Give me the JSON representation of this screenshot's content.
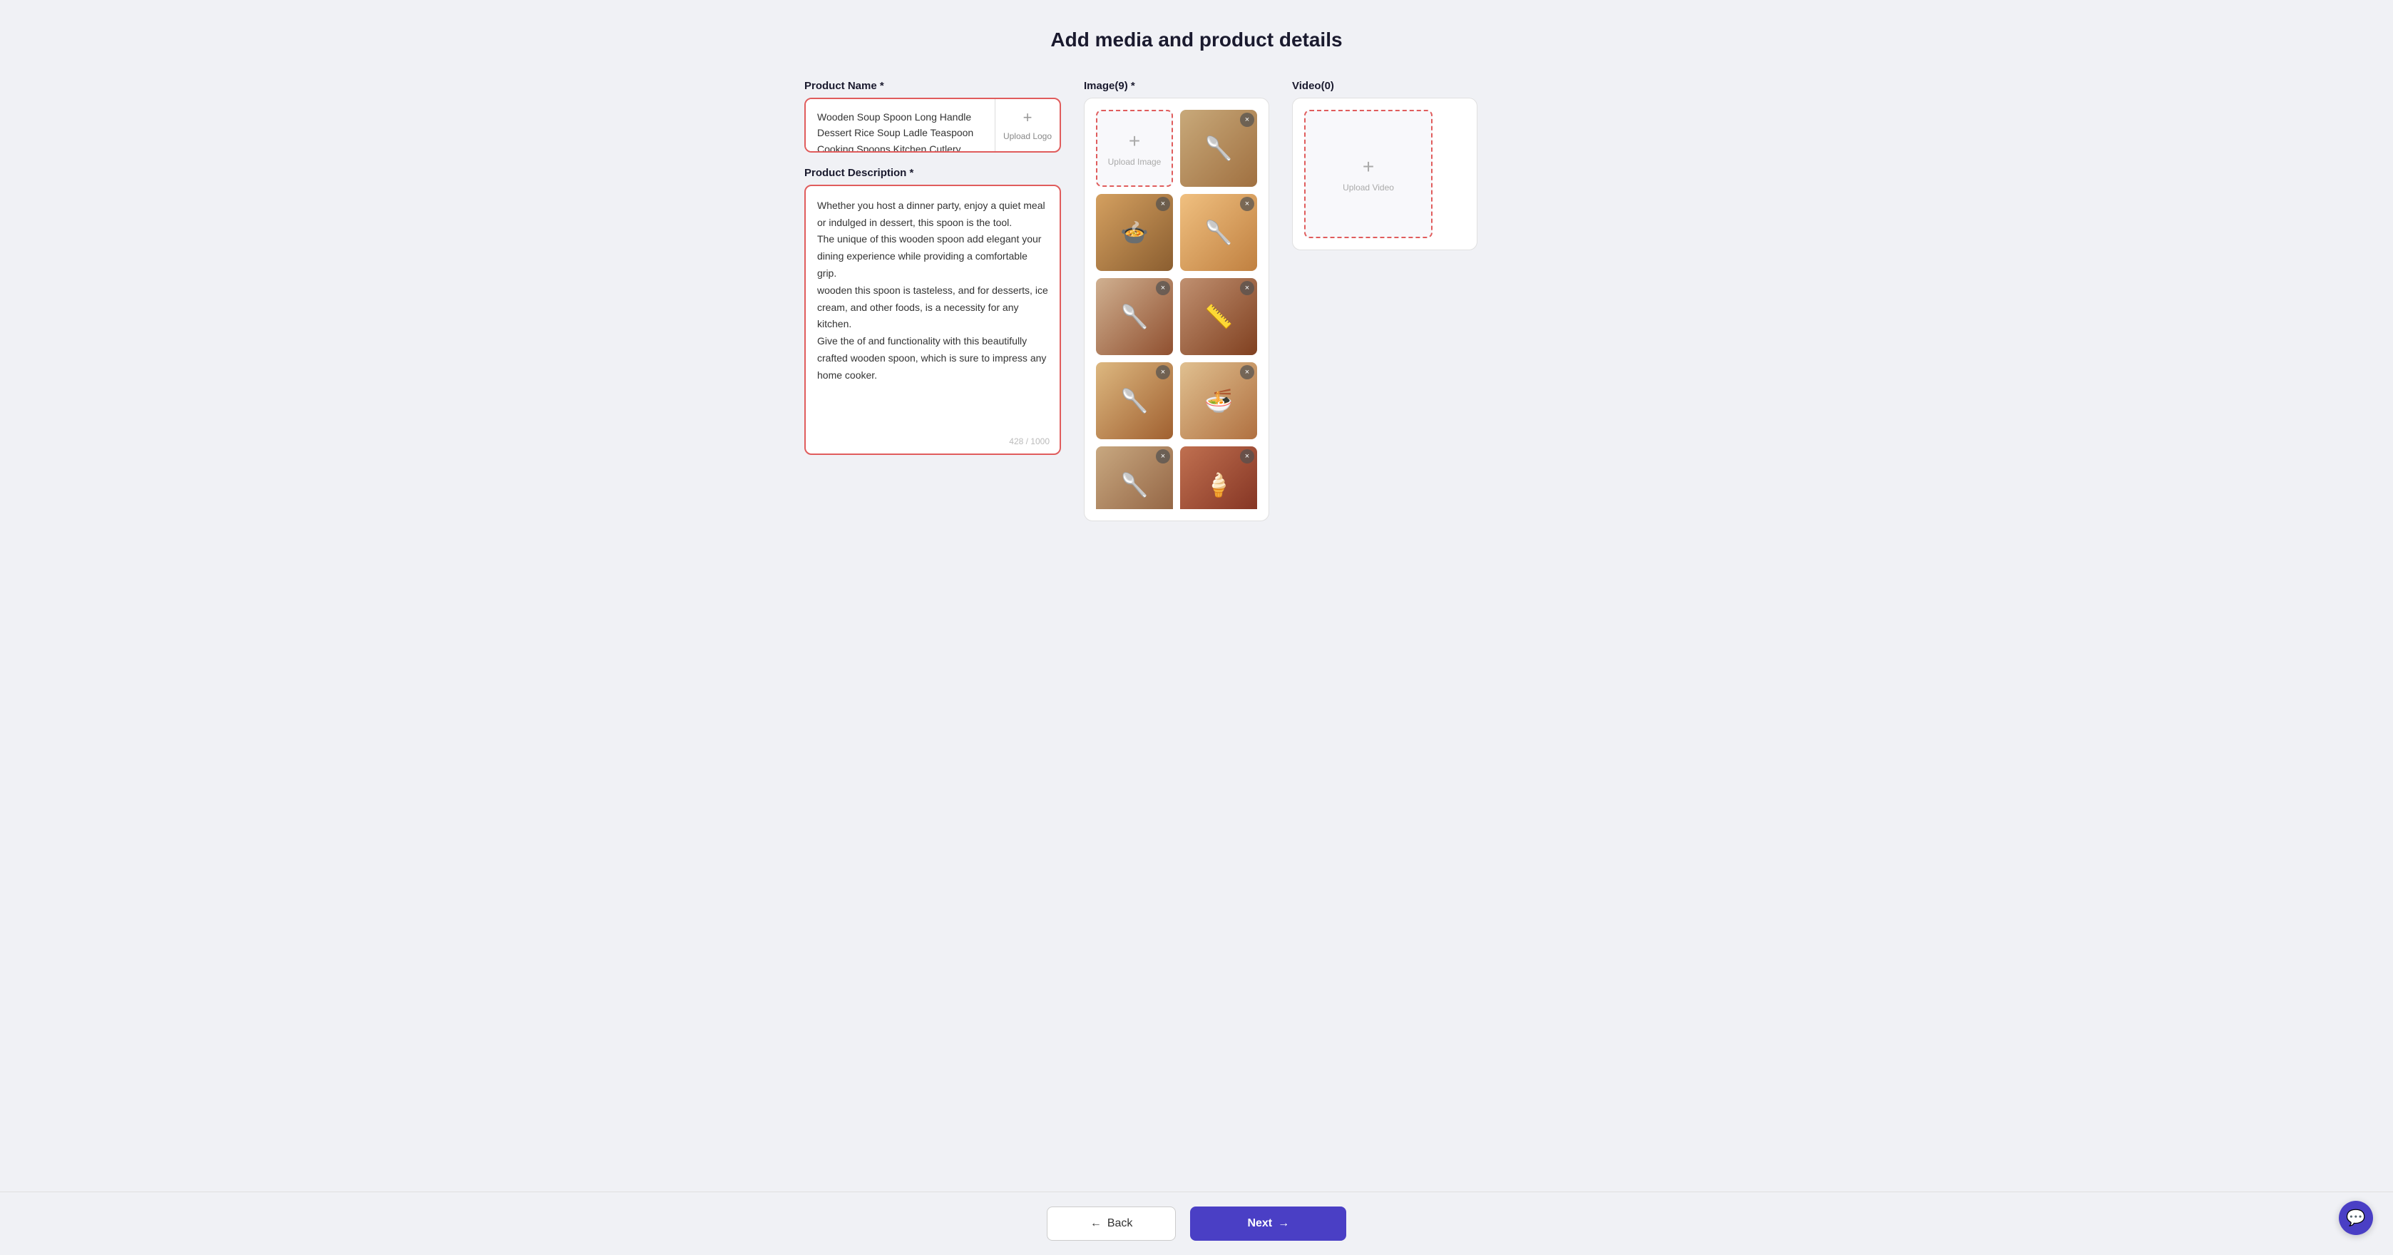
{
  "page": {
    "title": "Add media and product details"
  },
  "left": {
    "product_name_label": "Product Name *",
    "product_name_value": "Wooden Soup Spoon Long Handle Dessert Rice Soup Ladle Teaspoon Cooking Spoons Kitchen Cutlery Gadget",
    "upload_logo_label": "Upload Logo",
    "description_label": "Product Description *",
    "description_value": "Whether you host a dinner party, enjoy a quiet meal or indulged in dessert, this spoon is the tool.\nThe unique of this wooden spoon add elegant your dining experience while providing a comfortable grip.\nwooden this spoon is tasteless, and for desserts, ice cream, and other foods, is a necessity for any kitchen.\nGive the of and functionality with this beautifully crafted wooden spoon, which is sure to impress any home cooker.",
    "char_count": "428 / 1000"
  },
  "middle": {
    "label": "Image(9) *",
    "upload_image_label": "Upload Image",
    "images": [
      {
        "id": 1,
        "style": "img-spoon-main"
      },
      {
        "id": 2,
        "style": "img-spoon-2"
      },
      {
        "id": 3,
        "style": "img-spoon-3"
      },
      {
        "id": 4,
        "style": "img-spoon-4"
      },
      {
        "id": 5,
        "style": "img-spoon-5"
      },
      {
        "id": 6,
        "style": "img-spoon-6"
      },
      {
        "id": 7,
        "style": "img-spoon-7"
      },
      {
        "id": 8,
        "style": "img-spoon-8"
      },
      {
        "id": 9,
        "style": "img-spoon-9"
      }
    ]
  },
  "right": {
    "label": "Video(0)",
    "upload_video_label": "Upload Video"
  },
  "footer": {
    "back_label": "Back",
    "next_label": "Next",
    "back_arrow": "←",
    "next_arrow": "→"
  }
}
